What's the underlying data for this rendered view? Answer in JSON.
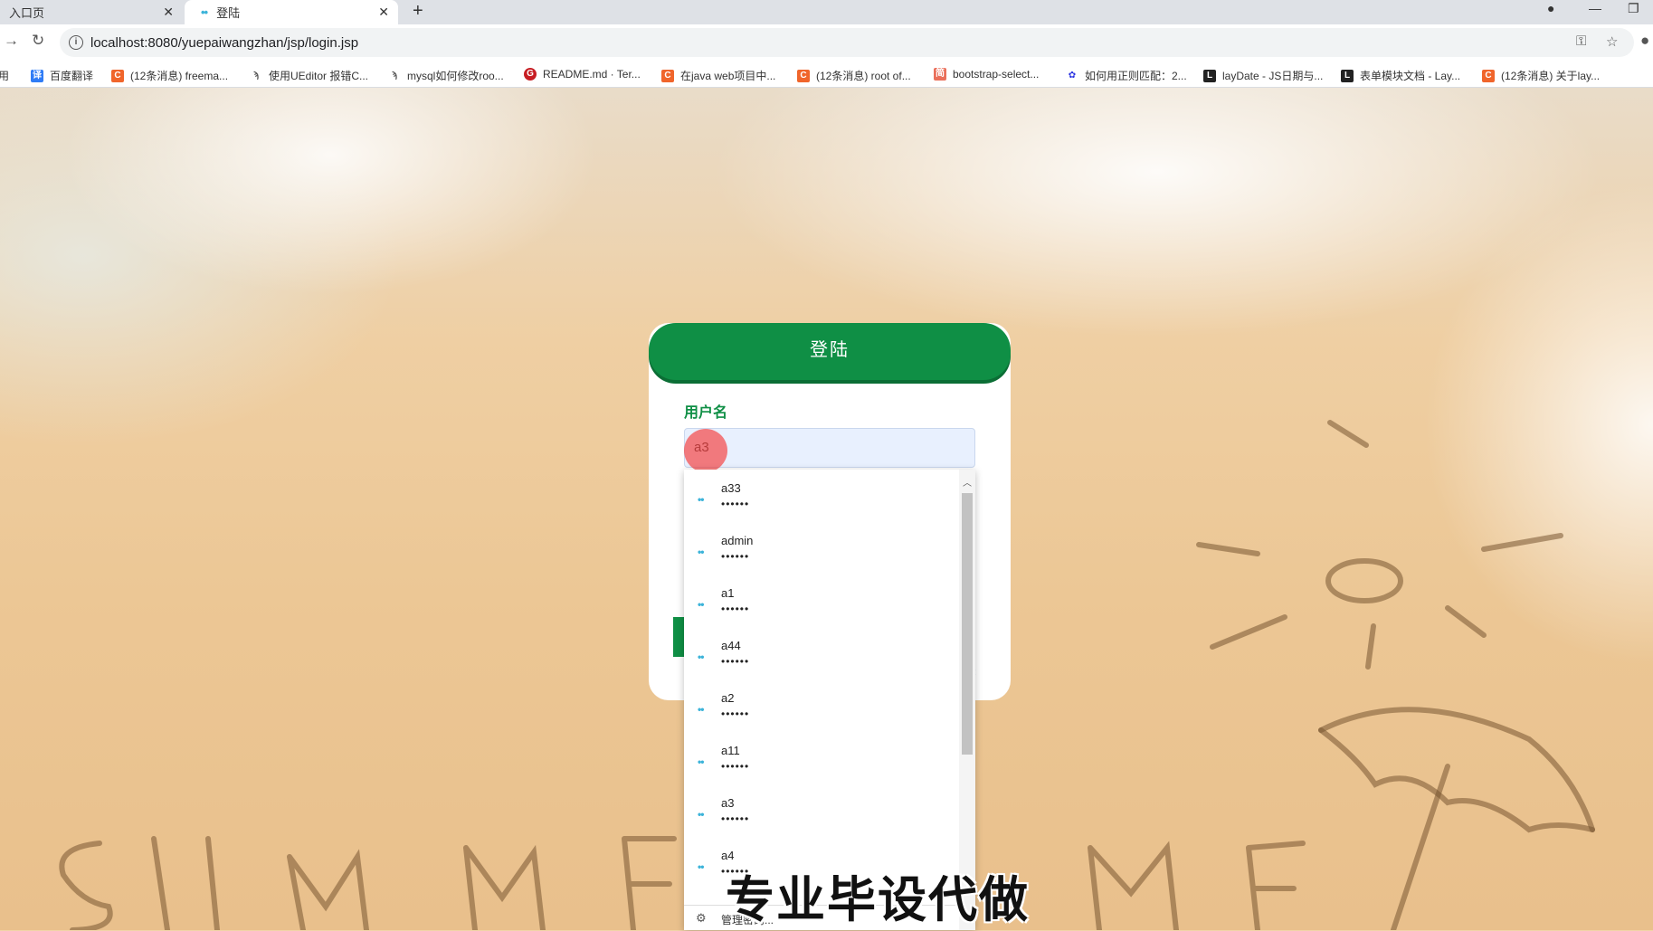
{
  "browser": {
    "tabs": [
      {
        "title": "入口页",
        "active": false
      },
      {
        "title": "登陆",
        "active": true
      }
    ],
    "new_tab_symbol": "+",
    "close_symbol": "✕",
    "url": "localhost:8080/yuepaiwangzhan/jsp/login.jsp",
    "bookmarks": [
      {
        "label": "应用",
        "icon": "apps-icon",
        "color": "#3c78d8"
      },
      {
        "label": "百度翻译",
        "icon": "baidu-translate-icon",
        "color": "#2f7cf6"
      },
      {
        "label": "(12条消息) freema...",
        "icon": "csdn-icon",
        "color": "#f0652b"
      },
      {
        "label": "使用UEditor 报错C...",
        "icon": "bird-icon",
        "color": "#555555"
      },
      {
        "label": "mysql如何修改roo...",
        "icon": "bird-icon",
        "color": "#555555"
      },
      {
        "label": "README.md · Ter...",
        "icon": "gitee-icon",
        "color": "#c71d23"
      },
      {
        "label": "在java web项目中...",
        "icon": "csdn-icon",
        "color": "#f0652b"
      },
      {
        "label": "(12条消息) root of...",
        "icon": "csdn-icon",
        "color": "#f0652b"
      },
      {
        "label": "bootstrap-select...",
        "icon": "jianshu-icon",
        "color": "#ea6f5a"
      },
      {
        "label": "如何用正则匹配：2...",
        "icon": "baidu-icon",
        "color": "#2932e1"
      },
      {
        "label": "layDate - JS日期与...",
        "icon": "layui-icon",
        "color": "#222222"
      },
      {
        "label": "表单模块文档 - Lay...",
        "icon": "layui-icon",
        "color": "#222222"
      },
      {
        "label": "(12条消息) 关于lay...",
        "icon": "csdn-icon",
        "color": "#f0652b"
      }
    ]
  },
  "login": {
    "title": "登陆",
    "username_label": "用户名",
    "username_value": "a3",
    "accent_color": "#0f8f45"
  },
  "autofill": {
    "entries": [
      {
        "username": "a33",
        "password": "••••••"
      },
      {
        "username": "admin",
        "password": "••••••"
      },
      {
        "username": "a1",
        "password": "••••••"
      },
      {
        "username": "a44",
        "password": "••••••"
      },
      {
        "username": "a2",
        "password": "••••••"
      },
      {
        "username": "a11",
        "password": "••••••"
      },
      {
        "username": "a3",
        "password": "••••••"
      },
      {
        "username": "a4",
        "password": "••••••"
      }
    ],
    "manage_label": "管理密码..."
  },
  "watermark": "专业毕设代做"
}
